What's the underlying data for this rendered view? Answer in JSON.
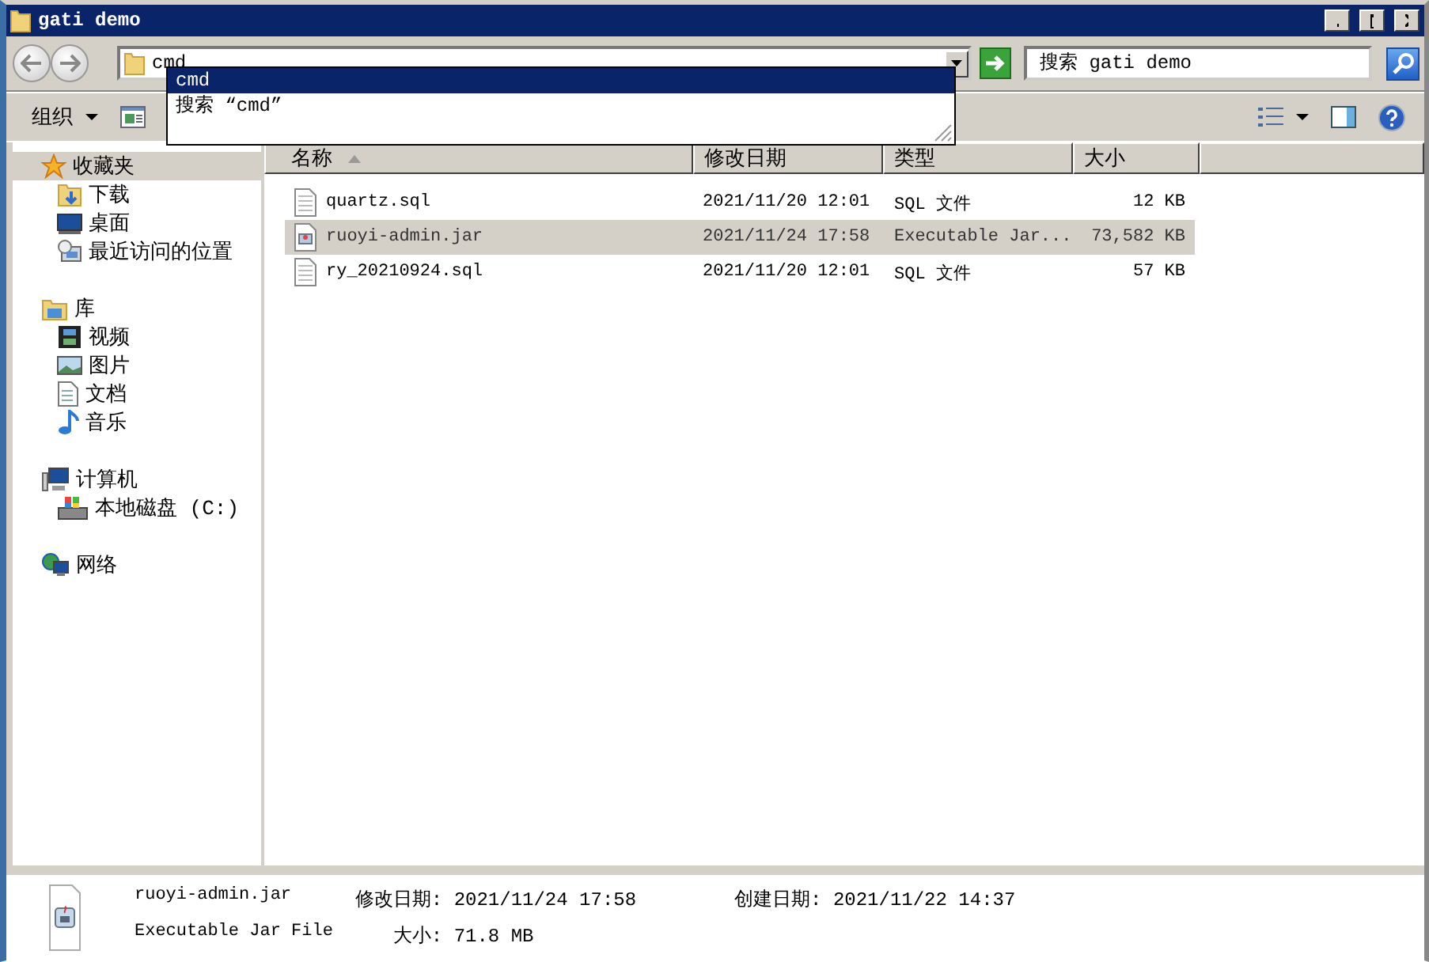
{
  "window": {
    "title": "gati demo"
  },
  "address": {
    "value": "cmd",
    "suggestions": [
      {
        "label": "cmd",
        "selected": true
      },
      {
        "label": "搜索 “cmd”",
        "selected": false
      }
    ]
  },
  "search": {
    "placeholder": "搜索 gati demo"
  },
  "toolbar": {
    "organize": "组织"
  },
  "sidebar": {
    "groups": [
      {
        "label": "收藏夹",
        "kind": "star",
        "selected": true,
        "children": [
          {
            "label": "下载",
            "kind": "download",
            "selected": false
          },
          {
            "label": "桌面",
            "kind": "desktop",
            "selected": false
          },
          {
            "label": "最近访问的位置",
            "kind": "recent",
            "selected": false
          }
        ]
      },
      {
        "label": "库",
        "kind": "library",
        "selected": false,
        "children": [
          {
            "label": "视频",
            "kind": "video",
            "selected": false
          },
          {
            "label": "图片",
            "kind": "image",
            "selected": false
          },
          {
            "label": "文档",
            "kind": "document",
            "selected": false
          },
          {
            "label": "音乐",
            "kind": "music",
            "selected": false
          }
        ]
      },
      {
        "label": "计算机",
        "kind": "computer",
        "selected": false,
        "children": [
          {
            "label": "本地磁盘 (C:)",
            "kind": "disk",
            "selected": false
          }
        ]
      },
      {
        "label": "网络",
        "kind": "network",
        "selected": false
      }
    ]
  },
  "table": {
    "columns": [
      {
        "label": "名称",
        "sorted": true
      },
      {
        "label": "修改日期",
        "sorted": false
      },
      {
        "label": "类型",
        "sorted": false
      },
      {
        "label": "大小",
        "sorted": false
      }
    ],
    "rows": [
      {
        "name": "quartz.sql",
        "kind": "text",
        "modified": "2021/11/20 12:01",
        "type": "SQL 文件",
        "size": "12 KB",
        "selected": false
      },
      {
        "name": "ruoyi-admin.jar",
        "kind": "jar",
        "modified": "2021/11/24 17:58",
        "type": "Executable Jar...",
        "size": "73,582 KB",
        "selected": true
      },
      {
        "name": "ry_20210924.sql",
        "kind": "text",
        "modified": "2021/11/20 12:01",
        "type": "SQL 文件",
        "size": "57 KB",
        "selected": false
      }
    ]
  },
  "details": {
    "name": "ruoyi-admin.jar",
    "type": "Executable Jar File",
    "modified_label": "修改日期:",
    "modified": "2021/11/24 17:58",
    "created_label": "创建日期:",
    "created": "2021/11/22 14:37",
    "size_label": "大小:",
    "size": "71.8 MB"
  }
}
